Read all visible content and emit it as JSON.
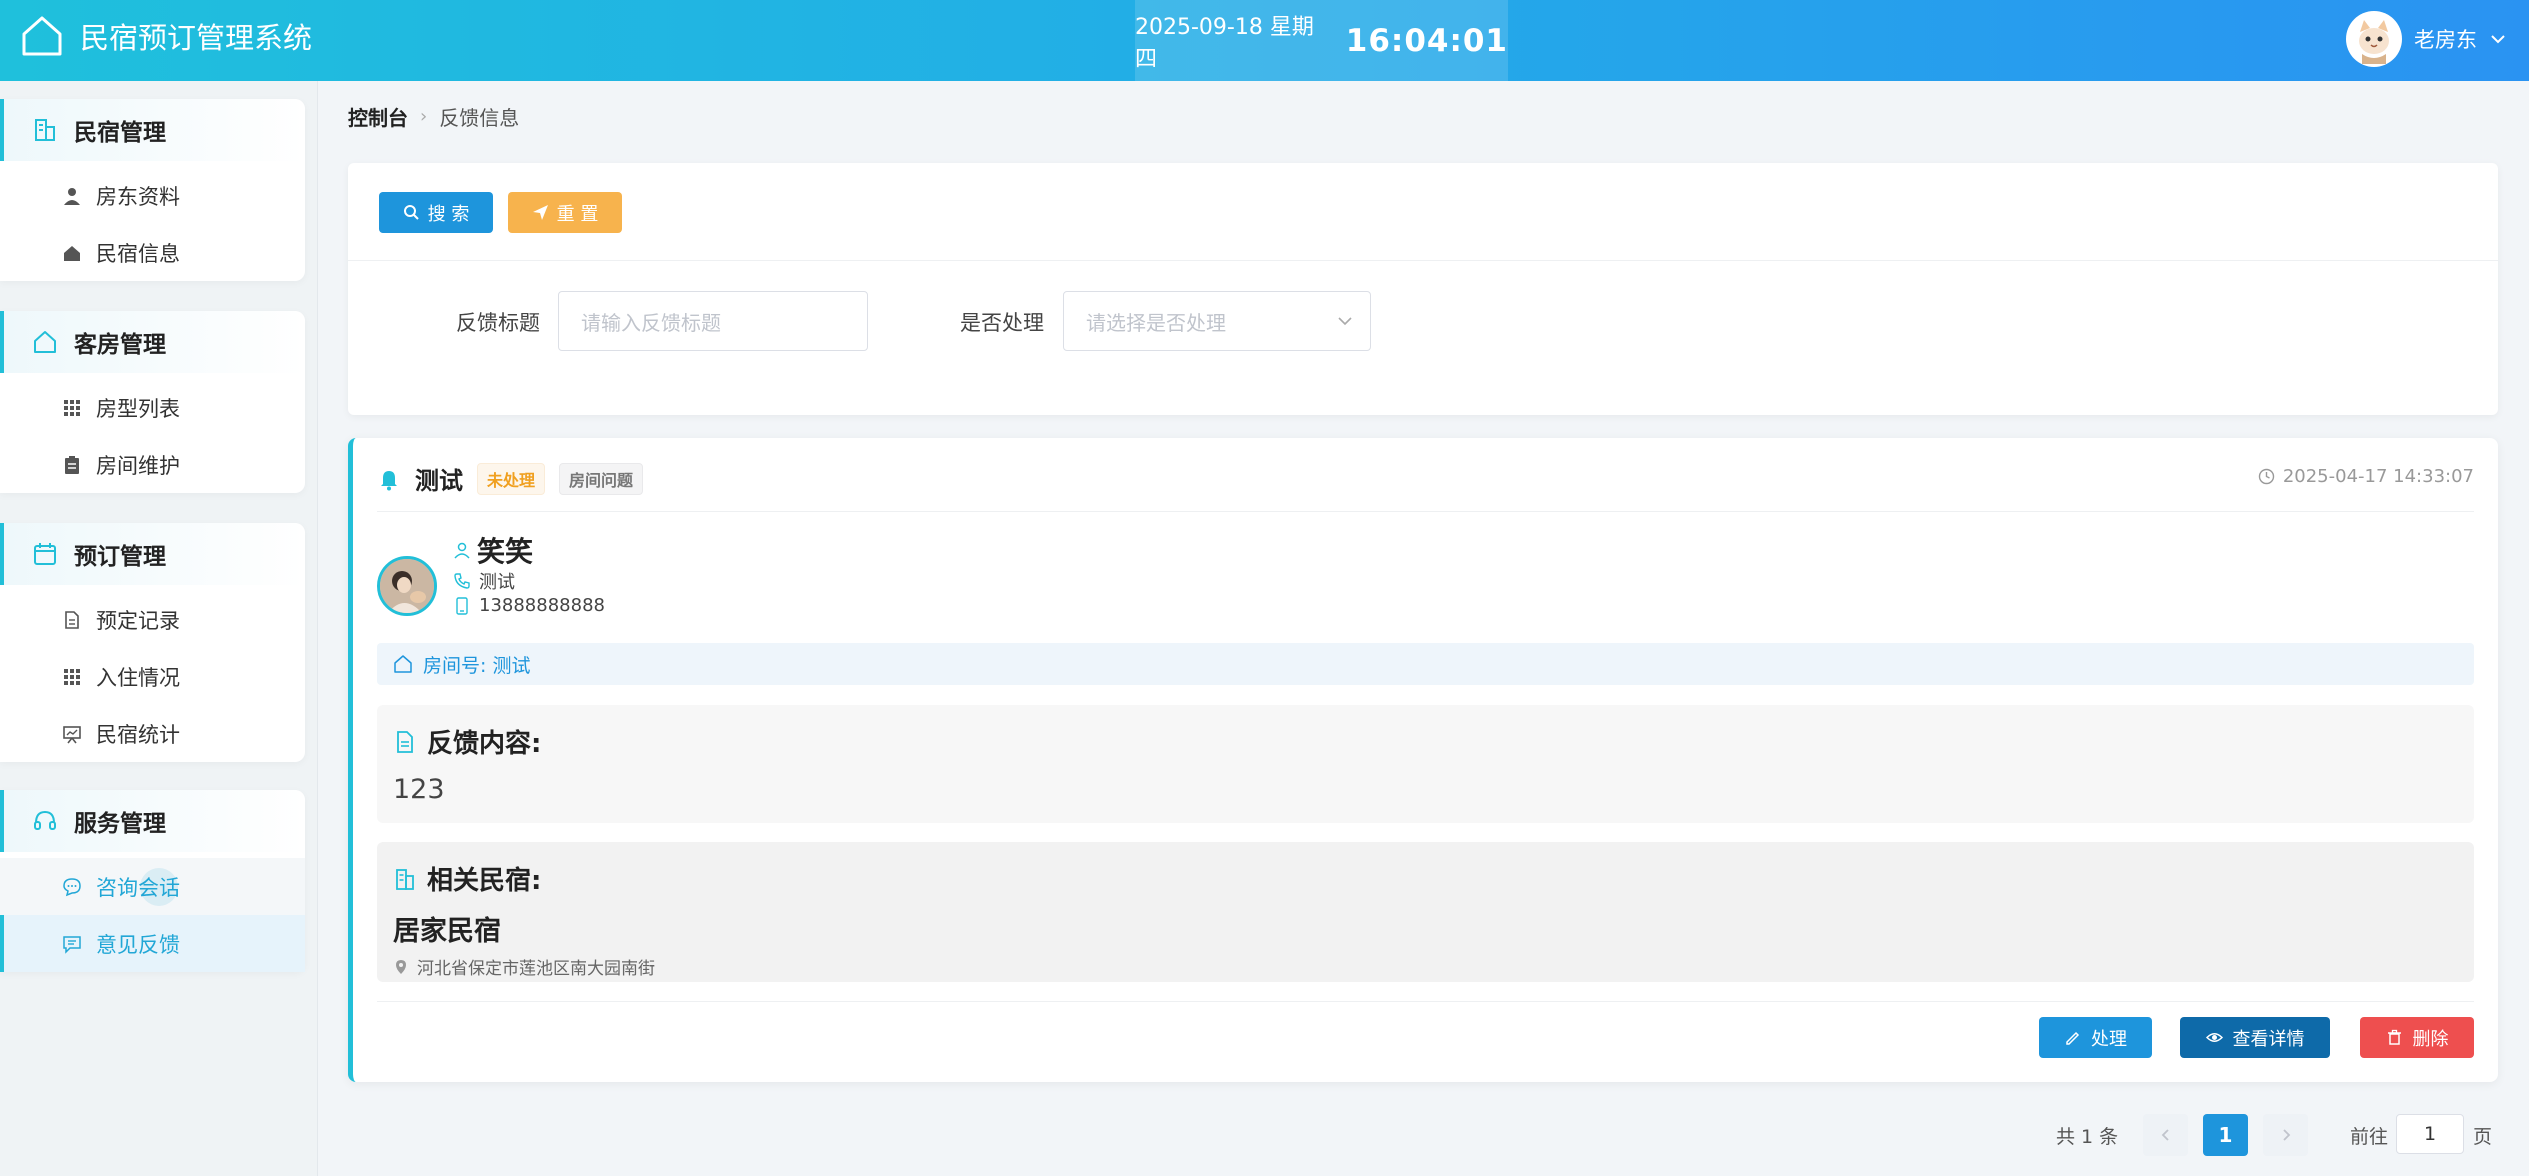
{
  "header": {
    "app_title": "民宿预订管理系统",
    "date": "2025-09-18 星期四",
    "time": "16:04:01",
    "user_name": "老房东"
  },
  "sidebar": {
    "groups": [
      {
        "label": "民宿管理",
        "icon": "building-icon",
        "items": [
          {
            "label": "房东资料",
            "icon": "user-icon"
          },
          {
            "label": "民宿信息",
            "icon": "home-icon"
          }
        ]
      },
      {
        "label": "客房管理",
        "icon": "house-outline-icon",
        "items": [
          {
            "label": "房型列表",
            "icon": "grid-icon"
          },
          {
            "label": "房间维护",
            "icon": "clipboard-icon"
          }
        ]
      },
      {
        "label": "预订管理",
        "icon": "calendar-icon",
        "items": [
          {
            "label": "预定记录",
            "icon": "document-icon"
          },
          {
            "label": "入住情况",
            "icon": "grid-icon"
          },
          {
            "label": "民宿统计",
            "icon": "presentation-icon"
          }
        ]
      },
      {
        "label": "服务管理",
        "icon": "headset-icon",
        "items": [
          {
            "label": "咨询会话",
            "icon": "chat-icon"
          },
          {
            "label": "意见反馈",
            "icon": "message-icon"
          }
        ]
      }
    ]
  },
  "breadcrumb": {
    "root": "控制台",
    "current": "反馈信息"
  },
  "search": {
    "search_label": "搜 索",
    "reset_label": "重 置",
    "title_label": "反馈标题",
    "title_placeholder": "请输入反馈标题",
    "handled_label": "是否处理",
    "handled_placeholder": "请选择是否处理"
  },
  "feedback": {
    "title": "测试",
    "status_tag": "未处理",
    "category_tag": "房间问题",
    "time": "2025-04-17 14:33:07",
    "user_name": "笑笑",
    "user_note": "测试",
    "phone": "13888888888",
    "room_label": "房间号: 测试",
    "content_heading": "反馈内容:",
    "content_text": "123",
    "homestay_heading": "相关民宿:",
    "homestay_name": "居家民宿",
    "homestay_address": "河北省保定市莲池区南大园南街",
    "actions": {
      "handle": "处理",
      "detail": "查看详情",
      "delete": "删除"
    }
  },
  "pagination": {
    "total_text": "共 1 条",
    "current_page": "1",
    "goto_label": "前往",
    "goto_value": "1",
    "page_suffix": "页"
  },
  "colors": {
    "accent": "#22bfd8",
    "primary": "#1e95dc",
    "warning": "#f7b34d",
    "danger": "#ee4f4f"
  }
}
